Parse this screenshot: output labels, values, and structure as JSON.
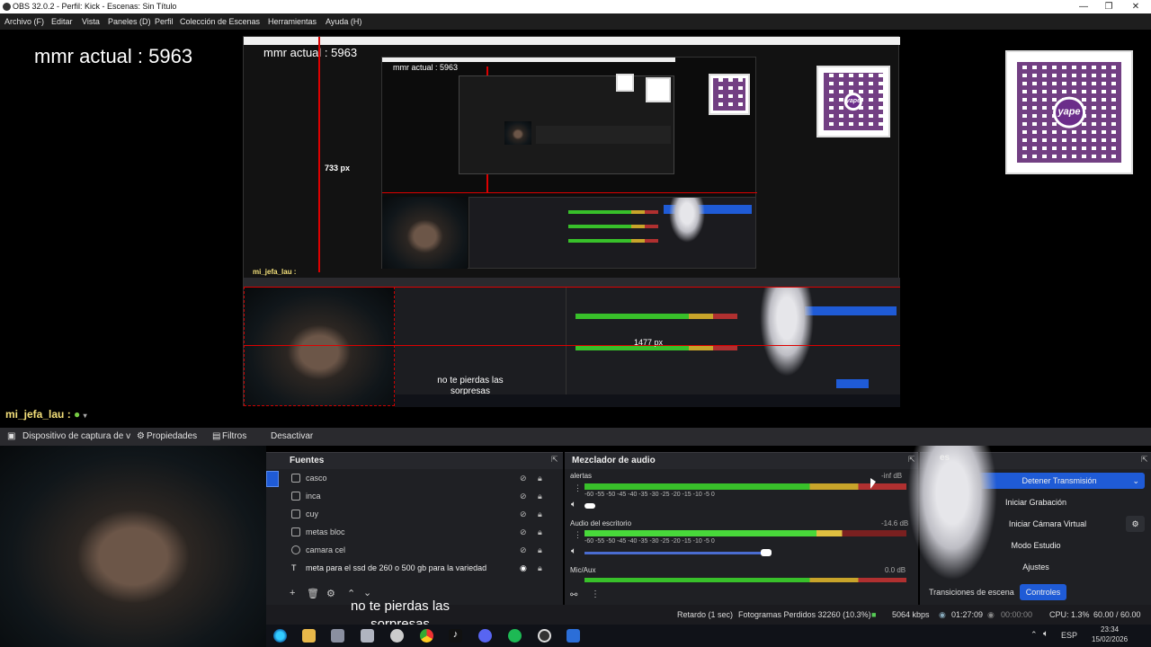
{
  "titlebar": {
    "title": "OBS 32.0.2 - Perfil: Kick - Escenas: Sin Título",
    "min": "—",
    "max": "❐",
    "close": "✕"
  },
  "menu": [
    "Archivo (F)",
    "Editar",
    "Vista",
    "Paneles (D)",
    "Perfil",
    "Colección de Escenas",
    "Herramientas",
    "Ayuda (H)"
  ],
  "overlay": {
    "mmr": "mmr actual : 5963",
    "mmr_small": "mmr actual : 5963",
    "mmr_tiny": "mmr actual : 5963",
    "px_733": "733 px",
    "px_1477": "1477 px",
    "qr_logo": "yape"
  },
  "scene": {
    "label": "mi_jefa_lau :",
    "small_label": "mi_jefa_lau :"
  },
  "source_toolbar": {
    "device": "Dispositivo de captura de v",
    "properties": "Propiedades",
    "filters": "Filtros",
    "deactivate": "Desactivar"
  },
  "sources": {
    "title": "Fuentes",
    "items": [
      {
        "label": "casco"
      },
      {
        "label": "inca"
      },
      {
        "label": "cuy"
      },
      {
        "label": "metas bloc"
      },
      {
        "label": "camara cel"
      },
      {
        "label": "meta para el ssd de 260 o 500 gb para la variedad"
      }
    ]
  },
  "mixer": {
    "title": "Mezclador de audio",
    "channels": [
      {
        "name": "alertas",
        "db": "-inf dB",
        "level": 0
      },
      {
        "name": "Audio del escritorio",
        "db": "-14.6 dB",
        "level": 0.78
      },
      {
        "name": "Mic/Aux",
        "db": "0.0 dB",
        "level": 0.95
      }
    ],
    "ticks": "-60    -55    -50    -45    -40    -35    -30    -25    -20    -15    -10     -5     0"
  },
  "controls": {
    "title": "Controles",
    "stop_stream": "Detener Transmisión",
    "start_recording": "Iniciar Grabación",
    "start_virtual_cam": "Iniciar Cámara Virtual",
    "studio_mode": "Modo Estudio",
    "settings": "Ajustes",
    "scene_transitions": "Transiciones de escena",
    "controls_tab": "Controles"
  },
  "captions": {
    "main": "no te pierdas las sorpresas",
    "small": "no te pierdas las sorpresas"
  },
  "status": {
    "delay": "Retardo (1 sec)",
    "dropped": "Fotogramas Perdidos 32260 (10.3%)",
    "bitrate": "5064 kbps",
    "live_time": "01:27:09",
    "rec_time": "00:00:00",
    "cpu": "CPU: 1.3%",
    "fps": "60.00 / 60.00 FPS"
  },
  "tray": {
    "lang": "ESP",
    "time": "23:34",
    "date": "15/02/2026"
  },
  "colors": {
    "accent": "#1f5bd6",
    "title_bg": "#ffffff",
    "dock_bg": "#1f2024",
    "red_guide": "#dd0000"
  }
}
